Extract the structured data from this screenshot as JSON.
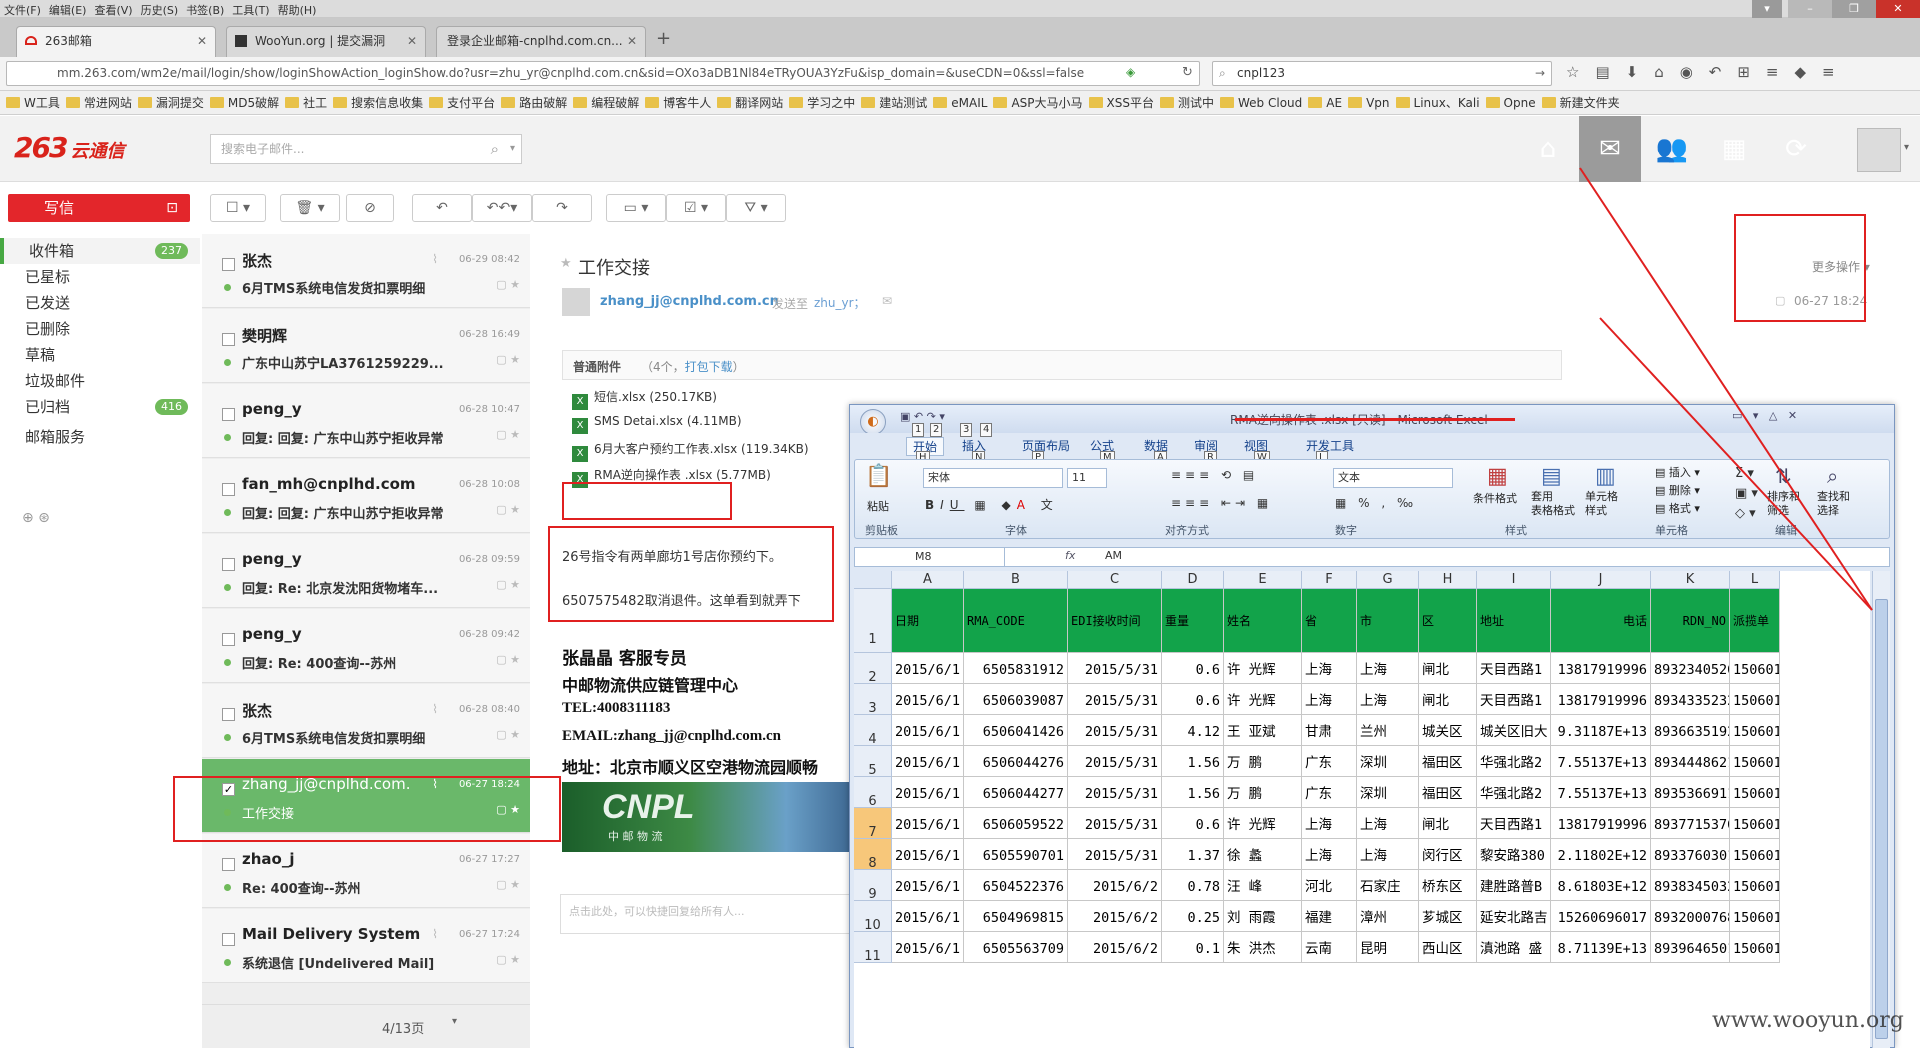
{
  "browser": {
    "menu": [
      "文件(F)",
      "编辑(E)",
      "查看(V)",
      "历史(S)",
      "书签(B)",
      "工具(T)",
      "帮助(H)"
    ],
    "tabs": [
      {
        "label": "263邮箱",
        "active": true
      },
      {
        "label": "WooYun.org | 提交漏洞",
        "active": false
      },
      {
        "label": "登录企业邮箱-cnplhd.com.cn...",
        "active": false
      }
    ],
    "new_tab": "+",
    "url": "mm.263.com/wm2e/mail/login/show/loginShowAction_loginShow.do?usr=zhu_yr@cnplhd.com.cn&sid=OXo3aDB1Nl84eTRyOUA3YzFu&isp_domain=&useCDN=0&ssl=false",
    "search_value": "cnpl123",
    "bookmarks": [
      "W工具",
      "常进网站",
      "漏洞提交",
      "MD5破解",
      "社工",
      "搜索信息收集",
      "支付平台",
      "路由破解",
      "编程破解",
      "博客牛人",
      "翻译网站",
      "学习之中",
      "建站测试",
      "eMAIL",
      "ASP大马小马",
      "XSS平台",
      "测试中",
      "Web Cloud",
      "AE",
      "Vpn",
      "Linux、Kali",
      "Opne",
      "新建文件夹"
    ]
  },
  "app": {
    "logo_mark": "263",
    "logo_text": "云通信",
    "search_placeholder": "搜索电子邮件...",
    "compose_label": "写信"
  },
  "folders": [
    {
      "label": "收件箱",
      "count": "237",
      "selected": true
    },
    {
      "label": "已星标",
      "count": ""
    },
    {
      "label": "已发送",
      "count": ""
    },
    {
      "label": "已删除",
      "count": ""
    },
    {
      "label": "草稿",
      "count": ""
    },
    {
      "label": "垃圾邮件",
      "count": ""
    },
    {
      "label": "已归档",
      "count": "416"
    },
    {
      "label": "邮箱服务",
      "count": ""
    }
  ],
  "mails": [
    {
      "from": "张杰",
      "time": "06-29 08:42",
      "subject": "6月TMS系统电信发货扣票明细",
      "attach": true
    },
    {
      "from": "樊明辉",
      "time": "06-28 16:49",
      "subject": "广东中山苏宁LA3761259229...",
      "attach": false
    },
    {
      "from": "peng_y",
      "time": "06-28 10:47",
      "subject": "回复: 回复: 广东中山苏宁拒收异常",
      "attach": false
    },
    {
      "from": "fan_mh@cnplhd.com",
      "time": "06-28 10:08",
      "subject": "回复: 回复: 广东中山苏宁拒收异常",
      "attach": false
    },
    {
      "from": "peng_y",
      "time": "06-28 09:59",
      "subject": "回复: Re: 北京发沈阳货物堵车...",
      "attach": false
    },
    {
      "from": "peng_y",
      "time": "06-28 09:42",
      "subject": "回复: Re: 400查询--苏州",
      "attach": false
    },
    {
      "from": "张杰",
      "time": "06-28 08:40",
      "subject": "6月TMS系统电信发货扣票明细",
      "attach": true
    },
    {
      "from": "zhang_jj@cnplhd.com.",
      "time": "06-27 18:24",
      "subject": "工作交接",
      "attach": true,
      "selected": true
    },
    {
      "from": "zhao_j",
      "time": "06-27 17:27",
      "subject": "Re: 400查询--苏州",
      "attach": false
    },
    {
      "from": "Mail Delivery System",
      "time": "06-27 17:24",
      "subject": "系统退信 [Undelivered Mail]",
      "attach": true
    }
  ],
  "pager": "4/13页",
  "reader": {
    "subject": "工作交接",
    "sender": "zhang_jj@cnplhd.com.cn",
    "sent_to_label": "发送至",
    "recipient": "zhu_yr；",
    "more_actions": "更多操作",
    "date": "06-27 18:24",
    "attach_title": "普通附件",
    "attach_count": "（4个，",
    "attach_pack": "打包下载",
    "attach_close": "）",
    "attachments": [
      "短信.xlsx (250.17KB)",
      "SMS Detai.xlsx (4.11MB)",
      "6月大客户预约工作表.xlsx (119.34KB)",
      "RMA逆向操作表 .xlsx (5.77MB)"
    ],
    "body_line1": "26号指令有两单廊坊1号店你预约下。",
    "body_line2": "6507575482取消退件。这单看到就弄下",
    "sig_name": "张晶晶  客服专员",
    "sig_org": "中邮物流供应链管理中心",
    "sig_tel": "TEL:4008311183",
    "sig_email": "EMAIL:zhang_jj@cnplhd.com.cn",
    "sig_addr": "地址：北京市顺义区空港物流园顺畅",
    "banner_text": "CNPL",
    "banner_sub": "中 邮 物 流",
    "reply_placeholder": "点击此处，可以快捷回复给所有人..."
  },
  "excel": {
    "title": "RMA逆向操作表 .xlsx [只读] - Microsoft Excel",
    "ribbon_tabs": [
      "开始",
      "插入",
      "页面布局",
      "公式",
      "数据",
      "审阅",
      "视图",
      "开发工具"
    ],
    "ribbon_keys": [
      "H",
      "N",
      "P",
      "M",
      "A",
      "R",
      "W",
      "L"
    ],
    "qat_keys": [
      "1",
      "2",
      "3",
      "4"
    ],
    "font_name": "宋体",
    "font_size": "11",
    "number_format": "文本",
    "group_labels": [
      "剪贴板",
      "字体",
      "对齐方式",
      "数字",
      "样式",
      "单元格",
      "编辑"
    ],
    "paste_label": "粘贴",
    "cond_format": "条件格式",
    "table_format": "套用\n表格格式",
    "cell_style": "单元格\n样式",
    "insert_label": "插入",
    "delete_label": "删除",
    "format_label": "格式",
    "sort_label": "排序和\n筛选",
    "find_label": "查找和\n选择",
    "name_box": "M8",
    "formula": "AM",
    "columns": [
      "A",
      "B",
      "C",
      "D",
      "E",
      "F",
      "G",
      "H",
      "I",
      "J",
      "K",
      "L"
    ],
    "header_row": [
      "日期",
      "RMA_CODE",
      "EDI接收时间",
      "重量",
      "姓名",
      "省",
      "市",
      "区",
      "地址",
      "电话",
      "RDN_NO",
      "派揽单"
    ],
    "rows": [
      [
        "2015/6/1",
        "6505831912",
        "2015/5/31",
        "0.6",
        "许 光辉",
        "上海",
        "上海",
        "闸北",
        "天目西路1",
        "13817919996",
        "8932340526",
        "150601("
      ],
      [
        "2015/6/1",
        "6506039087",
        "2015/5/31",
        "0.6",
        "许 光辉",
        "上海",
        "上海",
        "闸北",
        "天目西路1",
        "13817919996",
        "8934335232",
        "150601("
      ],
      [
        "2015/6/1",
        "6506041426",
        "2015/5/31",
        "4.12",
        "王 亚斌",
        "甘肃",
        "兰州",
        "城关区",
        "城关区旧大",
        "9.31187E+13",
        "8936635192",
        "150601("
      ],
      [
        "2015/6/1",
        "6506044276",
        "2015/5/31",
        "1.56",
        "万 鹏",
        "广东",
        "深圳",
        "福田区",
        "华强北路2",
        "7.55137E+13",
        "8934448621",
        "150601("
      ],
      [
        "2015/6/1",
        "6506044277",
        "2015/5/31",
        "1.56",
        "万 鹏",
        "广东",
        "深圳",
        "福田区",
        "华强北路2",
        "7.55137E+13",
        "8935366911",
        "150601("
      ],
      [
        "2015/6/1",
        "6506059522",
        "2015/5/31",
        "0.6",
        "许 光辉",
        "上海",
        "上海",
        "闸北",
        "天目西路1",
        "13817919996",
        "8937715376",
        "150601("
      ],
      [
        "2015/6/1",
        "6505590701",
        "2015/5/31",
        "1.37",
        "徐 蠡",
        "上海",
        "上海",
        "闵行区",
        "黎安路380",
        "2.11802E+12",
        "8933760301",
        "150601("
      ],
      [
        "2015/6/1",
        "6504522376",
        "2015/6/2",
        "0.78",
        "汪 峰",
        "河北",
        "石家庄",
        "桥东区",
        "建胜路普B",
        "8.61803E+12",
        "8938345032",
        "150601("
      ],
      [
        "2015/6/1",
        "6504969815",
        "2015/6/2",
        "0.25",
        "刘 雨霞",
        "福建",
        "漳州",
        "芗城区",
        "延安北路吉",
        "15260696017",
        "8932000768",
        "150601("
      ],
      [
        "2015/6/1",
        "6505563709",
        "2015/6/2",
        "0.1",
        "朱 洪杰",
        "云南",
        "昆明",
        "西山区",
        "滇池路 盛",
        "8.71139E+13",
        "8939646501",
        "150601("
      ]
    ],
    "row_numbers": [
      "1",
      "2",
      "3",
      "4",
      "5",
      "6",
      "7",
      "8",
      "9",
      "10",
      "11"
    ]
  },
  "watermark": "www.wooyun.org",
  "colors": {
    "brand_red": "#d9231b",
    "accent_green": "#6ab86a",
    "excel_header_green": "#12a34a",
    "annotation_red": "#e02020"
  }
}
